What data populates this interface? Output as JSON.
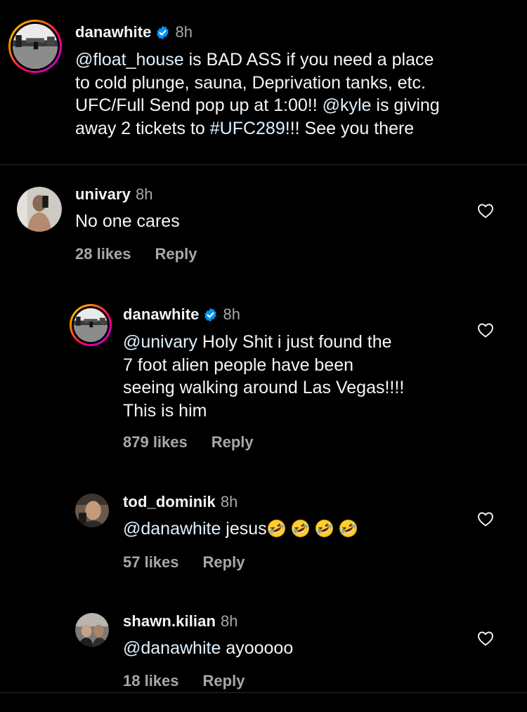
{
  "caption": {
    "username": "danawhite",
    "verified": true,
    "time": "8h",
    "lines": [
      {
        "mention": "@float_house",
        "rest": " is BAD ASS if you need a place"
      },
      {
        "text": "to cold plunge, sauna, Deprivation tanks, etc."
      },
      {
        "pre": "UFC/Full Send pop up at 1:00!! ",
        "mention": "@kyle",
        "rest": " is giving"
      },
      {
        "pre": "away 2 tickets to ",
        "mention": "#UFC289",
        "rest": "!!! See you there"
      }
    ]
  },
  "comments": [
    {
      "username": "univary",
      "time": "8h",
      "text": "No one cares",
      "likes": "28 likes",
      "reply": "Reply"
    },
    {
      "username": "danawhite",
      "verified": true,
      "time": "8h",
      "lines": [
        {
          "mention": "@univary",
          "rest": " Holy Shit i just found the"
        },
        {
          "text": "7 foot alien people have been"
        },
        {
          "text": "seeing walking around Las Vegas!!!!"
        },
        {
          "text": "This is him"
        }
      ],
      "likes": "879 likes",
      "reply": "Reply"
    },
    {
      "username": "tod_dominik",
      "time": "8h",
      "mention": "@danawhite",
      "rest": " jesus",
      "emojis": [
        "rolling-on-floor-laughing",
        "rolling-on-floor-laughing",
        "rolling-on-floor-laughing",
        "rolling-on-floor-laughing"
      ],
      "likes": "57 likes",
      "reply": "Reply"
    },
    {
      "username": "shawn.kilian",
      "time": "8h",
      "mention": "@danawhite",
      "rest": " ayooooo",
      "likes": "18 likes",
      "reply": "Reply"
    }
  ],
  "icons": {
    "like": "heart-outline-icon",
    "verified": "verified-badge-icon",
    "emoji": "rolling-on-floor-laughing-emoji"
  },
  "colors": {
    "background": "#000000",
    "text": "#f5f5f5",
    "secondary": "#a8a8a8",
    "mention": "#e0f1ff",
    "verified": "#0095f6",
    "divider": "#262626"
  }
}
